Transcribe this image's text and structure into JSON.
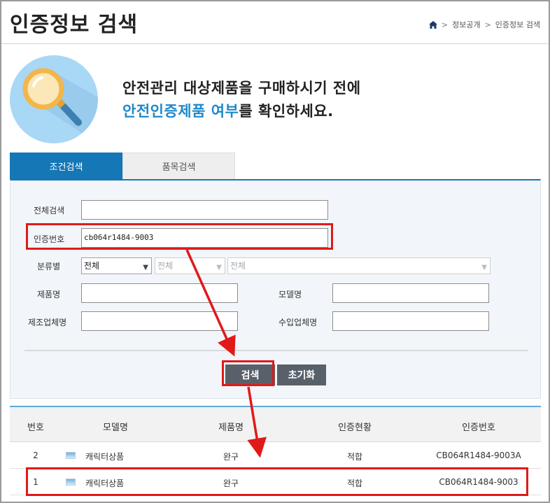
{
  "page": {
    "title": "인증정보 검색",
    "breadcrumb": [
      "정보공개",
      "인증정보 검색"
    ],
    "breadcrumb_sep": ">"
  },
  "hero": {
    "line1": "안전관리 대상제품을 구매하시기 전에",
    "line2_highlight": "안전인증제품 여부",
    "line2_rest": "를 확인하세요."
  },
  "tabs": [
    {
      "label": "조건검색",
      "active": true
    },
    {
      "label": "품목검색",
      "active": false
    }
  ],
  "form": {
    "full_search_label": "전체검색",
    "full_search_value": "",
    "cert_no_label": "인증번호",
    "cert_no_value": "cb064r1484-9003",
    "category_label": "분류별",
    "category_selects": [
      "전체",
      "전체",
      "전체"
    ],
    "product_name_label": "제품명",
    "model_name_label": "모델명",
    "manufacturer_label": "제조업체명",
    "importer_label": "수입업체명",
    "search_button": "검색",
    "reset_button": "초기화"
  },
  "table": {
    "headers": [
      "번호",
      "모델명",
      "제품명",
      "인증현황",
      "인증번호"
    ],
    "rows": [
      {
        "no": "2",
        "model": "캐릭터상품",
        "product": "완구",
        "status": "적합",
        "cert": "CB064R1484-9003A"
      },
      {
        "no": "1",
        "model": "캐릭터상품",
        "product": "완구",
        "status": "적합",
        "cert": "CB064R1484-9003"
      }
    ]
  },
  "colors": {
    "accent": "#1577b6",
    "highlight_text": "#1f88c9",
    "annotation_red": "#e11919",
    "button_gray": "#58616a"
  }
}
